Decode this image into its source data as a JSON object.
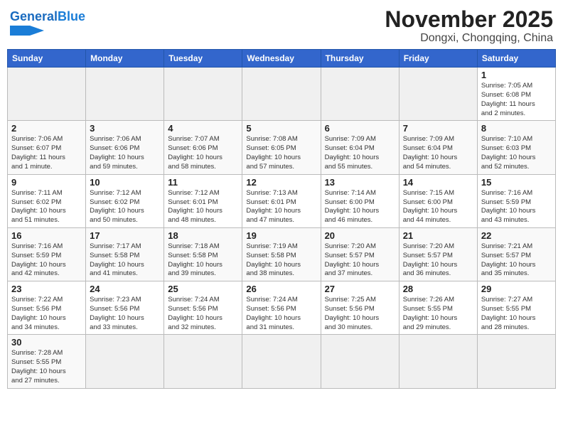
{
  "header": {
    "logo_general": "General",
    "logo_blue": "Blue",
    "month_title": "November 2025",
    "location": "Dongxi, Chongqing, China"
  },
  "weekdays": [
    "Sunday",
    "Monday",
    "Tuesday",
    "Wednesday",
    "Thursday",
    "Friday",
    "Saturday"
  ],
  "weeks": [
    [
      {
        "day": "",
        "info": ""
      },
      {
        "day": "",
        "info": ""
      },
      {
        "day": "",
        "info": ""
      },
      {
        "day": "",
        "info": ""
      },
      {
        "day": "",
        "info": ""
      },
      {
        "day": "",
        "info": ""
      },
      {
        "day": "1",
        "info": "Sunrise: 7:05 AM\nSunset: 6:08 PM\nDaylight: 11 hours\nand 2 minutes."
      }
    ],
    [
      {
        "day": "2",
        "info": "Sunrise: 7:06 AM\nSunset: 6:07 PM\nDaylight: 11 hours\nand 1 minute."
      },
      {
        "day": "3",
        "info": "Sunrise: 7:06 AM\nSunset: 6:06 PM\nDaylight: 10 hours\nand 59 minutes."
      },
      {
        "day": "4",
        "info": "Sunrise: 7:07 AM\nSunset: 6:06 PM\nDaylight: 10 hours\nand 58 minutes."
      },
      {
        "day": "5",
        "info": "Sunrise: 7:08 AM\nSunset: 6:05 PM\nDaylight: 10 hours\nand 57 minutes."
      },
      {
        "day": "6",
        "info": "Sunrise: 7:09 AM\nSunset: 6:04 PM\nDaylight: 10 hours\nand 55 minutes."
      },
      {
        "day": "7",
        "info": "Sunrise: 7:09 AM\nSunset: 6:04 PM\nDaylight: 10 hours\nand 54 minutes."
      },
      {
        "day": "8",
        "info": "Sunrise: 7:10 AM\nSunset: 6:03 PM\nDaylight: 10 hours\nand 52 minutes."
      }
    ],
    [
      {
        "day": "9",
        "info": "Sunrise: 7:11 AM\nSunset: 6:02 PM\nDaylight: 10 hours\nand 51 minutes."
      },
      {
        "day": "10",
        "info": "Sunrise: 7:12 AM\nSunset: 6:02 PM\nDaylight: 10 hours\nand 50 minutes."
      },
      {
        "day": "11",
        "info": "Sunrise: 7:12 AM\nSunset: 6:01 PM\nDaylight: 10 hours\nand 48 minutes."
      },
      {
        "day": "12",
        "info": "Sunrise: 7:13 AM\nSunset: 6:01 PM\nDaylight: 10 hours\nand 47 minutes."
      },
      {
        "day": "13",
        "info": "Sunrise: 7:14 AM\nSunset: 6:00 PM\nDaylight: 10 hours\nand 46 minutes."
      },
      {
        "day": "14",
        "info": "Sunrise: 7:15 AM\nSunset: 6:00 PM\nDaylight: 10 hours\nand 44 minutes."
      },
      {
        "day": "15",
        "info": "Sunrise: 7:16 AM\nSunset: 5:59 PM\nDaylight: 10 hours\nand 43 minutes."
      }
    ],
    [
      {
        "day": "16",
        "info": "Sunrise: 7:16 AM\nSunset: 5:59 PM\nDaylight: 10 hours\nand 42 minutes."
      },
      {
        "day": "17",
        "info": "Sunrise: 7:17 AM\nSunset: 5:58 PM\nDaylight: 10 hours\nand 41 minutes."
      },
      {
        "day": "18",
        "info": "Sunrise: 7:18 AM\nSunset: 5:58 PM\nDaylight: 10 hours\nand 39 minutes."
      },
      {
        "day": "19",
        "info": "Sunrise: 7:19 AM\nSunset: 5:58 PM\nDaylight: 10 hours\nand 38 minutes."
      },
      {
        "day": "20",
        "info": "Sunrise: 7:20 AM\nSunset: 5:57 PM\nDaylight: 10 hours\nand 37 minutes."
      },
      {
        "day": "21",
        "info": "Sunrise: 7:20 AM\nSunset: 5:57 PM\nDaylight: 10 hours\nand 36 minutes."
      },
      {
        "day": "22",
        "info": "Sunrise: 7:21 AM\nSunset: 5:57 PM\nDaylight: 10 hours\nand 35 minutes."
      }
    ],
    [
      {
        "day": "23",
        "info": "Sunrise: 7:22 AM\nSunset: 5:56 PM\nDaylight: 10 hours\nand 34 minutes."
      },
      {
        "day": "24",
        "info": "Sunrise: 7:23 AM\nSunset: 5:56 PM\nDaylight: 10 hours\nand 33 minutes."
      },
      {
        "day": "25",
        "info": "Sunrise: 7:24 AM\nSunset: 5:56 PM\nDaylight: 10 hours\nand 32 minutes."
      },
      {
        "day": "26",
        "info": "Sunrise: 7:24 AM\nSunset: 5:56 PM\nDaylight: 10 hours\nand 31 minutes."
      },
      {
        "day": "27",
        "info": "Sunrise: 7:25 AM\nSunset: 5:56 PM\nDaylight: 10 hours\nand 30 minutes."
      },
      {
        "day": "28",
        "info": "Sunrise: 7:26 AM\nSunset: 5:55 PM\nDaylight: 10 hours\nand 29 minutes."
      },
      {
        "day": "29",
        "info": "Sunrise: 7:27 AM\nSunset: 5:55 PM\nDaylight: 10 hours\nand 28 minutes."
      }
    ],
    [
      {
        "day": "30",
        "info": "Sunrise: 7:28 AM\nSunset: 5:55 PM\nDaylight: 10 hours\nand 27 minutes."
      },
      {
        "day": "",
        "info": ""
      },
      {
        "day": "",
        "info": ""
      },
      {
        "day": "",
        "info": ""
      },
      {
        "day": "",
        "info": ""
      },
      {
        "day": "",
        "info": ""
      },
      {
        "day": "",
        "info": ""
      }
    ]
  ]
}
